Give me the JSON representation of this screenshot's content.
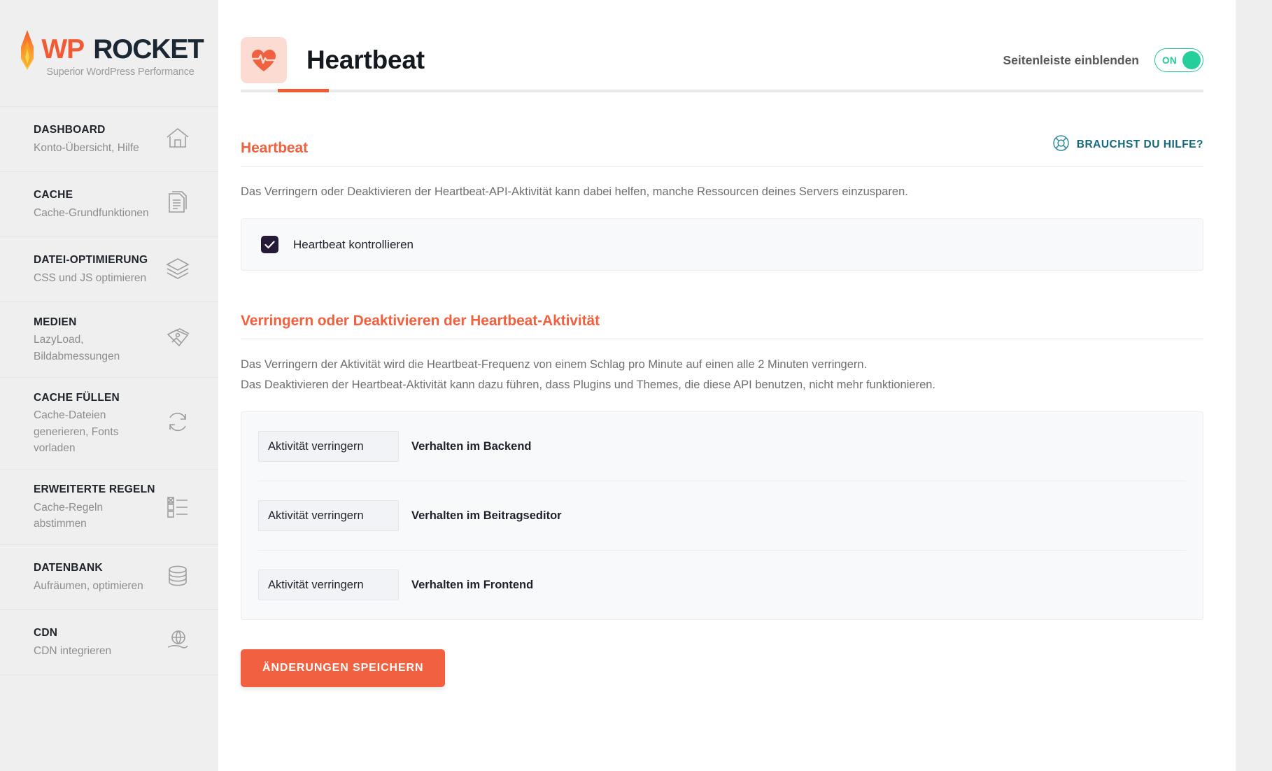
{
  "brand": {
    "name_primary": "WP",
    "name_secondary": "ROCKET",
    "tagline": "Superior WordPress Performance"
  },
  "sidebar": {
    "items": [
      {
        "title": "DASHBOARD",
        "sub": "Konto-Übersicht, Hilfe",
        "icon": "home-icon"
      },
      {
        "title": "CACHE",
        "sub": "Cache-Grundfunktionen",
        "icon": "document-icon"
      },
      {
        "title": "DATEI-OPTIMIERUNG",
        "sub": "CSS und JS optimieren",
        "icon": "layers-icon"
      },
      {
        "title": "MEDIEN",
        "sub": "LazyLoad, Bildabmessungen",
        "icon": "images-icon"
      },
      {
        "title": "CACHE FÜLLEN",
        "sub": "Cache-Dateien generieren, Fonts vorladen",
        "icon": "refresh-icon"
      },
      {
        "title": "ERWEITERTE REGELN",
        "sub": "Cache-Regeln abstimmen",
        "icon": "checklist-icon"
      },
      {
        "title": "DATENBANK",
        "sub": "Aufräumen, optimieren",
        "icon": "database-icon"
      },
      {
        "title": "CDN",
        "sub": "CDN integrieren",
        "icon": "globe-hand-icon"
      }
    ]
  },
  "header": {
    "title": "Heartbeat",
    "icon": "heartbeat-icon",
    "sidebar_toggle_label": "Seitenleiste einblenden",
    "toggle_state": "ON"
  },
  "main": {
    "section1": {
      "title": "Heartbeat",
      "help_label": "BRAUCHST DU HILFE?",
      "help_icon": "lifebuoy-icon",
      "description": "Das Verringern oder Deaktivieren der Heartbeat-API-Aktivität kann dabei helfen, manche Ressourcen deines Servers einzusparen.",
      "checkbox_label": "Heartbeat kontrollieren",
      "checkbox_checked": true
    },
    "section2": {
      "title": "Verringern oder Deaktivieren der Heartbeat-Aktivität",
      "description_line1": "Das Verringern der Aktivität wird die Heartbeat-Frequenz von einem Schlag pro Minute auf einen alle 2 Minuten verringern.",
      "description_line2": "Das Deaktivieren der Heartbeat-Aktivität kann dazu führen, dass Plugins und Themes, die diese API benutzen, nicht mehr funktionieren.",
      "rows": [
        {
          "value": "Aktivität verringern",
          "caption": "Verhalten im Backend"
        },
        {
          "value": "Aktivität verringern",
          "caption": "Verhalten im Beitragseditor"
        },
        {
          "value": "Aktivität verringern",
          "caption": "Verhalten im Frontend"
        }
      ]
    },
    "save_label": "ÄNDERUNGEN SPEICHERN"
  },
  "colors": {
    "accent": "#f2613f",
    "accent_logo": "#f05a34",
    "help_teal": "#14697e",
    "toggle_green": "#25cf9c",
    "checkbox_dark": "#271a36"
  }
}
